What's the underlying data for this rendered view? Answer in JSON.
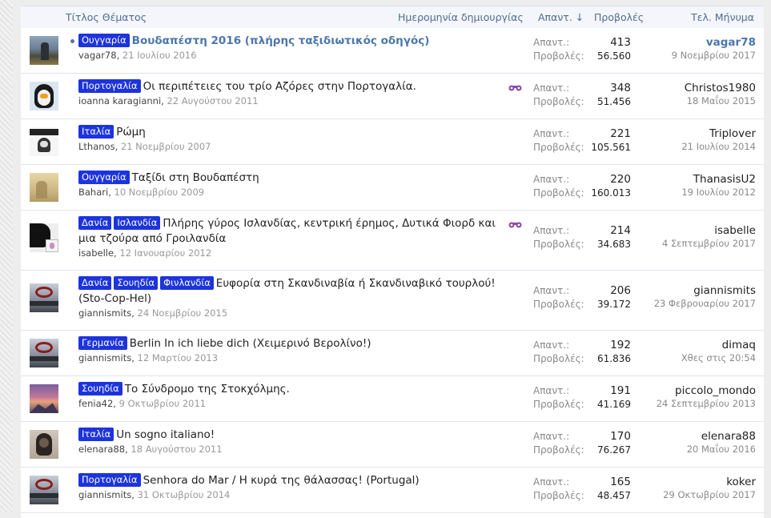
{
  "header": {
    "title_col": "Τίτλος Θέματος",
    "date_col": "Ημερομηνία δημιουργίας",
    "replies_col": "Απαντ. ↓",
    "views_col": "Προβολές",
    "last_col": "Τελ. Μήνυμα"
  },
  "labels": {
    "replies": "Απαντ.:",
    "views": "Προβολές:"
  },
  "threads": [
    {
      "tags": [
        "Ουγγαρία"
      ],
      "title": "Βουδαπέστη 2016 (πλήρης ταξιδιωτικός οδηγός)",
      "author": "vagar78",
      "date": "21 Ιουλίου 2016",
      "replies": "413",
      "views": "56.560",
      "last_user": "vagar78",
      "last_date": "9 Νοεμβρίου 2017"
    },
    {
      "tags": [
        "Πορτογαλία"
      ],
      "title": "Οι περιπέτειες του τρίο Αζόρες στην Πορτογαλία.",
      "author": "ioanna karagianni",
      "date": "22 Αυγούστου 2011",
      "replies": "348",
      "views": "51.456",
      "last_user": "Christos1980",
      "last_date": "18 Μαΐου 2015"
    },
    {
      "tags": [
        "Ιταλία"
      ],
      "title": "Ρώμη",
      "author": "Lthanos",
      "date": "21 Νοεμβρίου 2007",
      "replies": "221",
      "views": "105.561",
      "last_user": "Triplover",
      "last_date": "21 Ιουλίου 2014"
    },
    {
      "tags": [
        "Ουγγαρία"
      ],
      "title": "Ταξίδι στη Βουδαπέστη",
      "author": "Bahari",
      "date": "10 Νοεμβρίου 2009",
      "replies": "220",
      "views": "160.013",
      "last_user": "ThanasisU2",
      "last_date": "19 Ιουλίου 2012"
    },
    {
      "tags": [
        "Δανία",
        "Ισλανδία"
      ],
      "title": "Πλήρης γύρος Ισλανδίας, κεντρική έρημος, Δυτικά Φιορδ και μια τζούρα από Γροιλανδία",
      "author": "isabelle",
      "date": "12 Ιανουαρίου 2012",
      "replies": "214",
      "views": "34.683",
      "last_user": "isabelle",
      "last_date": "4 Σεπτεμβρίου 2017"
    },
    {
      "tags": [
        "Δανία",
        "Σουηδία",
        "Φινλανδία"
      ],
      "title": "Ευφορία στη Σκανδιναβία ή Σκανδιναβικό τουρλού! (Sto-Cop-Hel)",
      "author": "giannismits",
      "date": "24 Νοεμβρίου 2015",
      "replies": "206",
      "views": "39.172",
      "last_user": "giannismits",
      "last_date": "23 Φεβρουαρίου 2017"
    },
    {
      "tags": [
        "Γερμανία"
      ],
      "title": "Berlin In ich liebe dich (Χειμερινό Βερολίνο!)",
      "author": "giannismits",
      "date": "12 Μαρτίου 2013",
      "replies": "192",
      "views": "61.836",
      "last_user": "dimaq",
      "last_date": "Χθες στις 20:54"
    },
    {
      "tags": [
        "Σουηδία"
      ],
      "title": "Το Σύνδρομο της Στοκχόλμης.",
      "author": "fenia42",
      "date": "9 Οκτωβρίου 2011",
      "replies": "191",
      "views": "41.169",
      "last_user": "piccolo_mondo",
      "last_date": "24 Σεπτεμβρίου 2013"
    },
    {
      "tags": [
        "Ιταλία"
      ],
      "title": "Un sogno italiano!",
      "author": "elenara88",
      "date": "18 Αυγούστου 2011",
      "replies": "170",
      "views": "76.267",
      "last_user": "elenara88",
      "last_date": "20 Μαΐου 2016"
    },
    {
      "tags": [
        "Πορτογαλία"
      ],
      "title": "Senhora do Mar / Η κυρά της θάλασσας! (Portugal)",
      "author": "giannismits",
      "date": "31 Οκτωβρίου 2014",
      "replies": "165",
      "views": "48.457",
      "last_user": "koker",
      "last_date": "29 Οκτωβρίου 2017"
    }
  ]
}
